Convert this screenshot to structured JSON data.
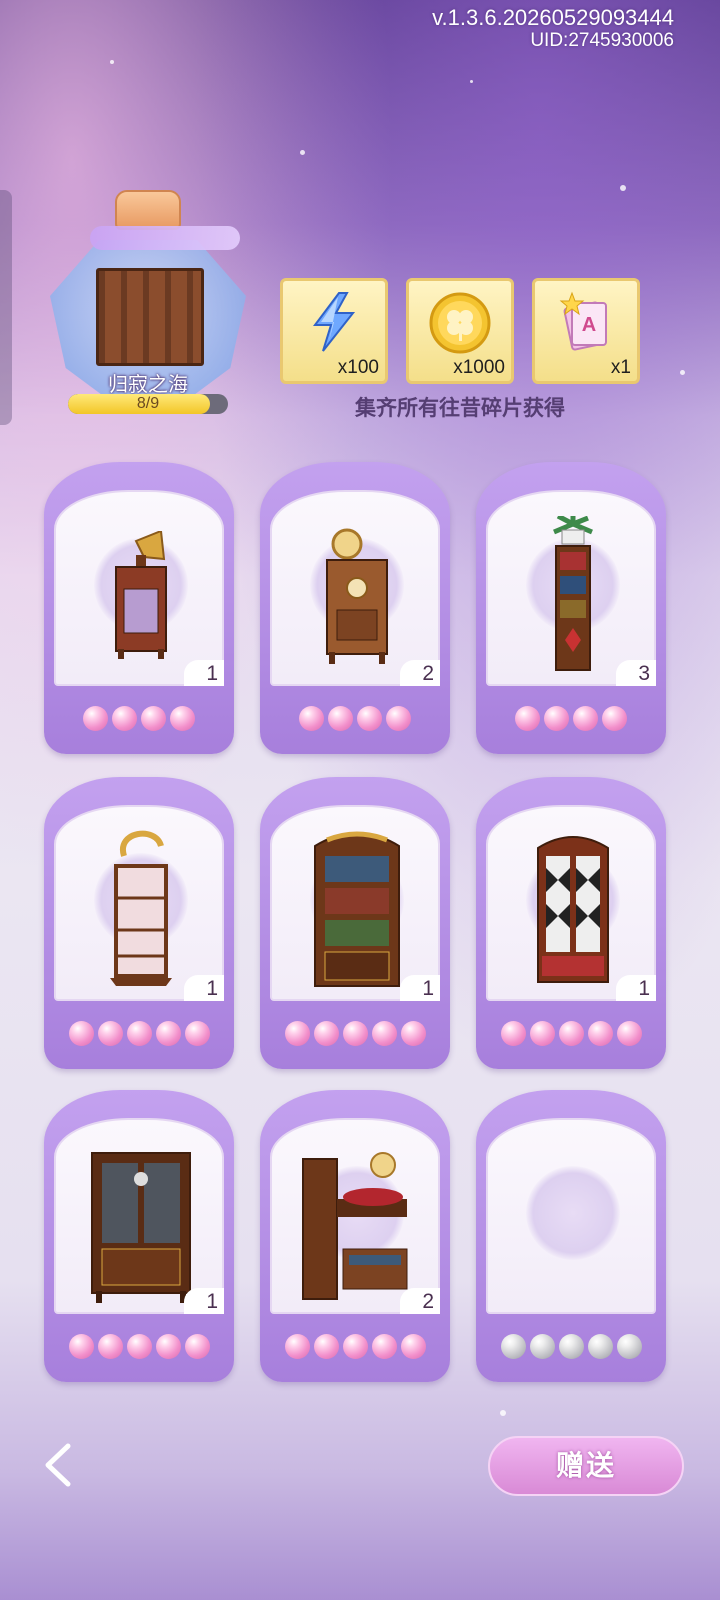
{
  "header": {
    "version": "v.1.3.6.20260529093444",
    "uid": "UID:2745930006"
  },
  "set": {
    "name": "归寂之海",
    "progress_text": "8/9",
    "progress_fraction": 0.889
  },
  "rewards": [
    {
      "icon": "lightning-energy-icon",
      "qty": "x100"
    },
    {
      "icon": "clover-coin-icon",
      "qty": "x1000"
    },
    {
      "icon": "star-card-pack-icon",
      "qty": "x1"
    }
  ],
  "hint": "集齐所有往昔碎片获得",
  "cards": [
    {
      "item": "gramophone-cabinet",
      "count": "1",
      "stars": 4,
      "filled": 4
    },
    {
      "item": "clock-cabinet",
      "count": "2",
      "stars": 4,
      "filled": 4
    },
    {
      "item": "plant-tall-bookshelf",
      "count": "3",
      "stars": 4,
      "filled": 4
    },
    {
      "item": "curio-display-shelf",
      "count": "1",
      "stars": 5,
      "filled": 5
    },
    {
      "item": "tall-bookcase",
      "count": "1",
      "stars": 5,
      "filled": 5
    },
    {
      "item": "diamond-door-wardrobe",
      "count": "1",
      "stars": 5,
      "filled": 5
    },
    {
      "item": "glass-display-cabinet",
      "count": "1",
      "stars": 5,
      "filled": 5
    },
    {
      "item": "ship-model-shelf",
      "count": "2",
      "stars": 5,
      "filled": 5
    },
    {
      "item": "empty-slot",
      "count": "",
      "stars": 5,
      "filled": 0
    }
  ],
  "actions": {
    "gift_label": "赠送"
  },
  "colors": {
    "accent": "#a77fdc",
    "button": "#d98ad6",
    "pearl": "#f28fcb"
  }
}
